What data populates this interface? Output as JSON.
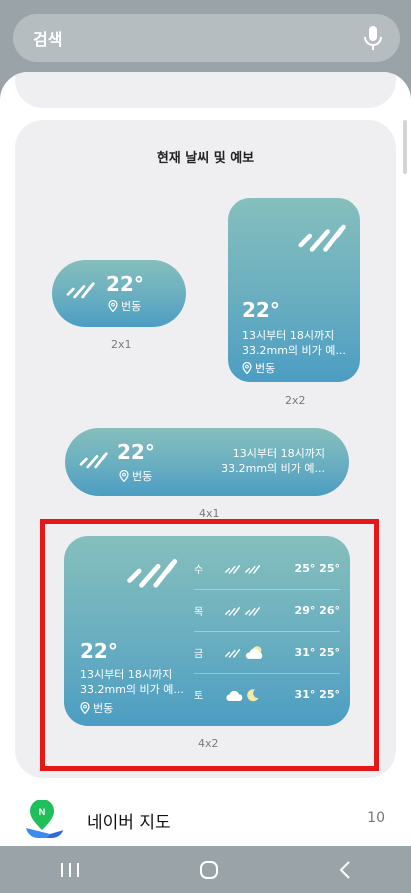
{
  "search": {
    "placeholder": "검색",
    "icon": "mic-icon"
  },
  "group": {
    "title": "현재 날씨 및 예보",
    "widgets": [
      {
        "size": "2x1",
        "temp": "22°",
        "location": "번동"
      },
      {
        "size": "2x2",
        "temp": "22°",
        "forecast_line1": "13시부터 18시까지",
        "forecast_line2": "33.2mm의 비가 예...",
        "location": "번동"
      },
      {
        "size": "4x1",
        "temp": "22°",
        "location": "번동",
        "forecast_line1": "13시부터 18시까지",
        "forecast_line2": "33.2mm의 비가 예..."
      },
      {
        "size": "4x2",
        "temp": "22°",
        "forecast_line1": "13시부터 18시까지",
        "forecast_line2": "33.2mm의 비가 예...",
        "location": "번동",
        "days": [
          {
            "day": "수",
            "icons": [
              "rain-icon",
              "rain-icon"
            ],
            "temps": "25° 25°"
          },
          {
            "day": "목",
            "icons": [
              "rain-icon",
              "rain-icon"
            ],
            "temps": "29° 26°"
          },
          {
            "day": "금",
            "icons": [
              "rain-icon",
              "cloud-sun-icon"
            ],
            "temps": "31° 25°"
          },
          {
            "day": "토",
            "icons": [
              "cloud-icon",
              "moon-icon"
            ],
            "temps": "31° 25°"
          }
        ]
      }
    ]
  },
  "app": {
    "name": "네이버 지도",
    "count": "10",
    "icon": "naver-map-icon"
  },
  "nav": {
    "icons": [
      "recents-icon",
      "home-icon",
      "back-icon"
    ]
  },
  "colors": {
    "highlight": "#e61717",
    "widget_top": "#85bfbd",
    "widget_bottom": "#4c9dc3"
  }
}
